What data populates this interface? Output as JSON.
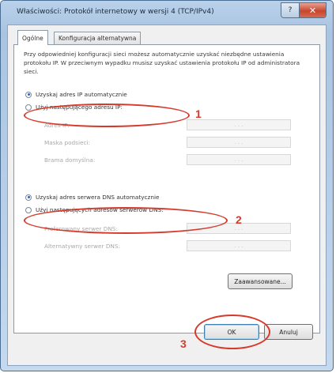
{
  "window": {
    "title": "Właściwości: Protokół internetowy w wersji 4 (TCP/IPv4)",
    "help_glyph": "?",
    "close_glyph": "✕"
  },
  "tabs": [
    {
      "label": "Ogólne",
      "active": true
    },
    {
      "label": "Konfiguracja alternatywna",
      "active": false
    }
  ],
  "general": {
    "description": "Przy odpowiedniej konfiguracji sieci możesz automatycznie uzyskać niezbędne ustawienia protokołu IP. W przeciwnym wypadku musisz uzyskać ustawienia protokołu IP od administratora sieci.",
    "ip_auto_label": "Uzyskaj adres IP automatycznie",
    "ip_manual_label": "Użyj następującego adresu IP:",
    "ip_fields": [
      {
        "label": "Adres IP:"
      },
      {
        "label": "Maska podsieci:"
      },
      {
        "label": "Brama domyślna:"
      }
    ],
    "dns_auto_label": "Uzyskaj adres serwera DNS automatycznie",
    "dns_manual_label": "Użyj następujących adresów serwerów DNS:",
    "dns_fields": [
      {
        "label": "Preferowany serwer DNS:"
      },
      {
        "label": "Alternatywny serwer DNS:"
      }
    ],
    "ip_auto_selected": true,
    "dns_auto_selected": true
  },
  "ip_box_dots": ".   .   .",
  "buttons": {
    "advanced": "Zaawansowane...",
    "ok": "OK",
    "cancel": "Anuluj"
  },
  "annotations": {
    "step1": "1",
    "step2": "2",
    "step3": "3",
    "highlight_color": "#d63a2c"
  }
}
